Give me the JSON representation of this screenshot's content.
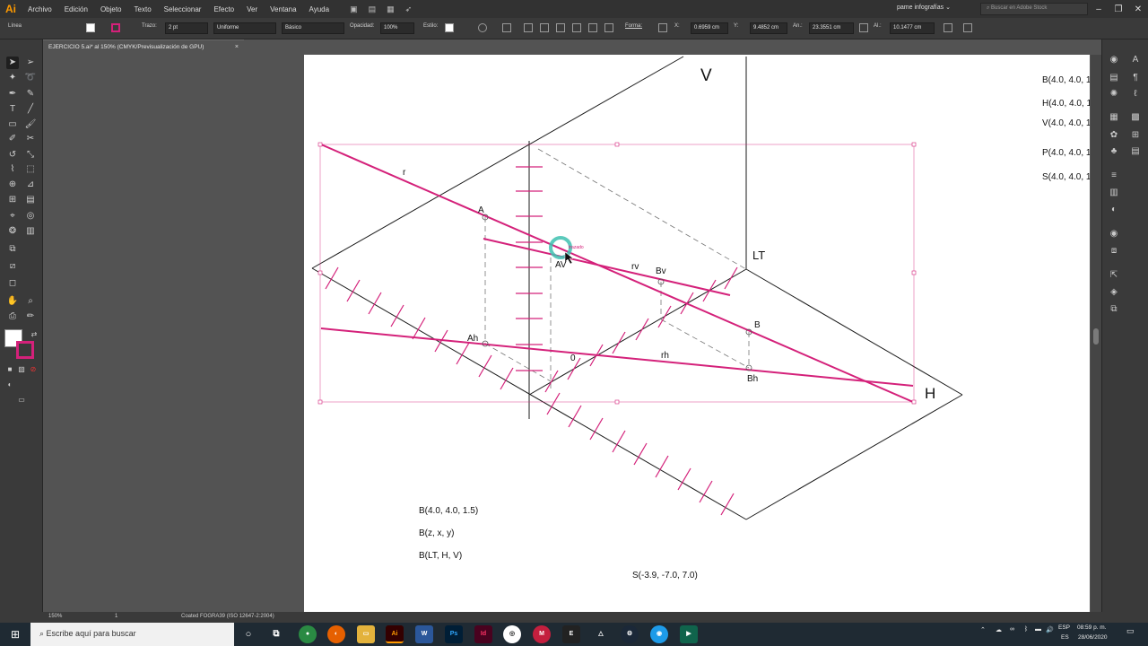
{
  "menubar": {
    "logo": "Ai",
    "items": [
      "Archivo",
      "Edición",
      "Objeto",
      "Texto",
      "Seleccionar",
      "Efecto",
      "Ver",
      "Ventana",
      "Ayuda"
    ],
    "workspace": "pame infografías",
    "stock_search_placeholder": "Buscar en Adobe Stock"
  },
  "controlbar": {
    "selection_label": "Línea",
    "stroke_label": "Trazo:",
    "stroke_weight": "2 pt",
    "profile": "Uniforme",
    "brush": "Básico",
    "opacity_label": "Opacidad:",
    "opacity": "100%",
    "style_label": "Estilo:",
    "shape_label": "Forma:",
    "x_label": "X:",
    "x": "0.6959 cm",
    "y_label": "Y:",
    "y": "9.4852 cm",
    "w_label": "An.:",
    "w": "23.3551 cm",
    "h_label": "Al.:",
    "h": "10.1477 cm"
  },
  "document": {
    "tab_title": "EJERCICIO 5.ai* al 150% (CMYK/Previsualización de GPU)",
    "close": "×"
  },
  "drawing": {
    "plane_labels": {
      "v": "V",
      "h": "H",
      "lt": "LT"
    },
    "points": {
      "r": "r",
      "a": "A",
      "av": "AV",
      "ah": "Ah",
      "rv": "rv",
      "bv": "Bv",
      "b": "B",
      "rh": "rh",
      "bh": "Bh",
      "zero": "0"
    },
    "smart_guide": "trazado",
    "notes_bottom": [
      "B(4.0, 4.0, 1.5)",
      "B(z, x, y)",
      "B(LT, H, V)"
    ],
    "note_s": "S(-3.9, -7.0, 7.0)",
    "notes_right": [
      "B(4.0, 4.0, 1",
      "H(4.0, 4.0, 1",
      "V(4.0, 4.0, 1",
      "P(4.0, 4.0, 1",
      "S(4.0, 4.0, 1"
    ],
    "accent_color": "#d4217a"
  },
  "statusbar": {
    "zoom": "150%",
    "artboard": "1",
    "profile": "Coated FOGRA39 (ISO 12647-2:2004)"
  },
  "taskbar": {
    "search_placeholder": "Escribe aquí para buscar",
    "language": "ESP",
    "language_sub": "ES",
    "time": "08:59 p. m.",
    "date": "28/06/2020"
  }
}
